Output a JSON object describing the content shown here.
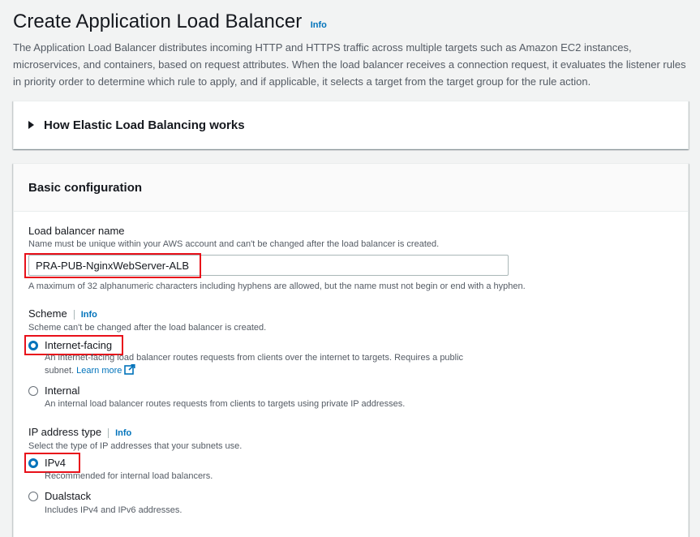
{
  "header": {
    "title": "Create Application Load Balancer",
    "info_label": "Info",
    "description": "The Application Load Balancer distributes incoming HTTP and HTTPS traffic across multiple targets such as Amazon EC2 instances, microservices, and containers, based on request attributes. When the load balancer receives a connection request, it evaluates the listener rules in priority order to determine which rule to apply, and if applicable, it selects a target from the target group for the rule action."
  },
  "how_section": {
    "label": "How Elastic Load Balancing works",
    "expanded": false
  },
  "basic_config": {
    "title": "Basic configuration",
    "name_field": {
      "label": "Load balancer name",
      "description": "Name must be unique within your AWS account and can't be changed after the load balancer is created.",
      "value": "PRA-PUB-NginxWebServer-ALB",
      "constraint": "A maximum of 32 alphanumeric characters including hyphens are allowed, but the name must not begin or end with a hyphen."
    },
    "scheme": {
      "label": "Scheme",
      "info_label": "Info",
      "description": "Scheme can't be changed after the load balancer is created.",
      "selected": "Internet-facing",
      "options": [
        {
          "label": "Internet-facing",
          "description_line1": "An internet-facing load balancer routes requests from clients over the internet to targets. Requires a public",
          "description_line2": "subnet.",
          "link_text": "Learn more"
        },
        {
          "label": "Internal",
          "description_line1": "An internal load balancer routes requests from clients to targets using private IP addresses."
        }
      ]
    },
    "ip_type": {
      "label": "IP address type",
      "info_label": "Info",
      "description": "Select the type of IP addresses that your subnets use.",
      "selected": "IPv4",
      "options": [
        {
          "label": "IPv4",
          "description_line1": "Recommended for internal load balancers."
        },
        {
          "label": "Dualstack",
          "description_line1": "Includes IPv4 and IPv6 addresses."
        }
      ]
    }
  },
  "colors": {
    "link": "#0073bb",
    "highlight": "#e8101a",
    "radio_selected": "#0073bb",
    "background": "#f2f3f3"
  },
  "icons": {
    "expander": "caret-right-icon",
    "external_link": "external-link-icon"
  }
}
